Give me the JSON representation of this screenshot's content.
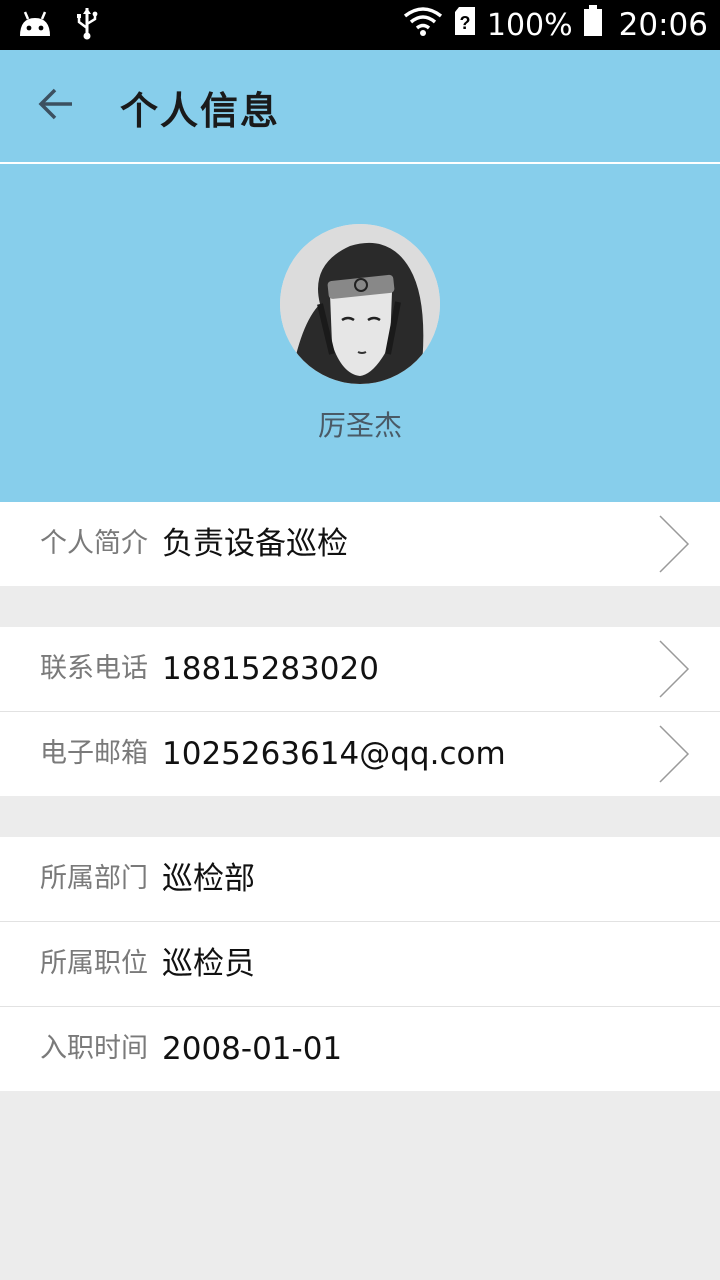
{
  "status_bar": {
    "battery_percent": "100%",
    "time": "20:06",
    "icons": [
      "android-icon",
      "usb-icon",
      "wifi-icon",
      "sim-unknown-icon",
      "battery-icon"
    ]
  },
  "app_bar": {
    "title": "个人信息",
    "back_icon": "arrow-left-icon"
  },
  "profile": {
    "name": "厉圣杰",
    "avatar": "avatar-portrait"
  },
  "sections": [
    {
      "rows": [
        {
          "label": "个人简介",
          "value": "负责设备巡检",
          "chevron": true
        }
      ]
    },
    {
      "rows": [
        {
          "label": "联系电话",
          "value": "18815283020",
          "chevron": true
        },
        {
          "label": "电子邮箱",
          "value": "1025263614@qq.com",
          "chevron": true
        }
      ]
    },
    {
      "rows": [
        {
          "label": "所属部门",
          "value": "巡检部",
          "chevron": false
        },
        {
          "label": "所属职位",
          "value": "巡检员",
          "chevron": false
        },
        {
          "label": "入职时间",
          "value": "2008-01-01",
          "chevron": false
        }
      ]
    }
  ],
  "colors": {
    "accent": "#87ceeb",
    "background": "#ececec",
    "text_primary": "#111111",
    "text_secondary": "#7a7a7a"
  }
}
